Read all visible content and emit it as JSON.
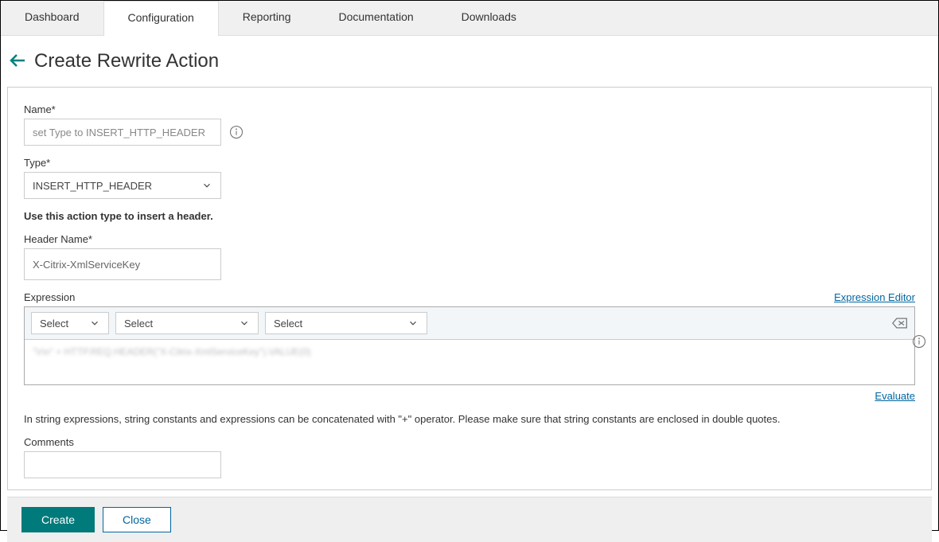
{
  "tabs": {
    "dashboard": "Dashboard",
    "configuration": "Configuration",
    "reporting": "Reporting",
    "documentation": "Documentation",
    "downloads": "Downloads"
  },
  "page": {
    "title": "Create Rewrite Action"
  },
  "form": {
    "name_label": "Name*",
    "name_placeholder": "set Type to INSERT_HTTP_HEADER",
    "type_label": "Type*",
    "type_value": "INSERT_HTTP_HEADER",
    "type_note": "Use this action type to insert a header.",
    "header_name_label": "Header Name*",
    "header_name_value": "X-Citrix-XmlServiceKey",
    "expression_label": "Expression",
    "expression_editor_link": "Expression Editor",
    "select_placeholder": "Select",
    "expression_value": "\"\\r\\n\" + HTTP.REQ.HEADER(\"X-Citrix-XmlServiceKey\").VALUE(0)",
    "evaluate_link": "Evaluate",
    "help_text": "In string expressions, string constants and expressions can be concatenated with \"+\" operator. Please make sure that string constants are enclosed in double quotes.",
    "comments_label": "Comments"
  },
  "footer": {
    "create": "Create",
    "close": "Close"
  }
}
